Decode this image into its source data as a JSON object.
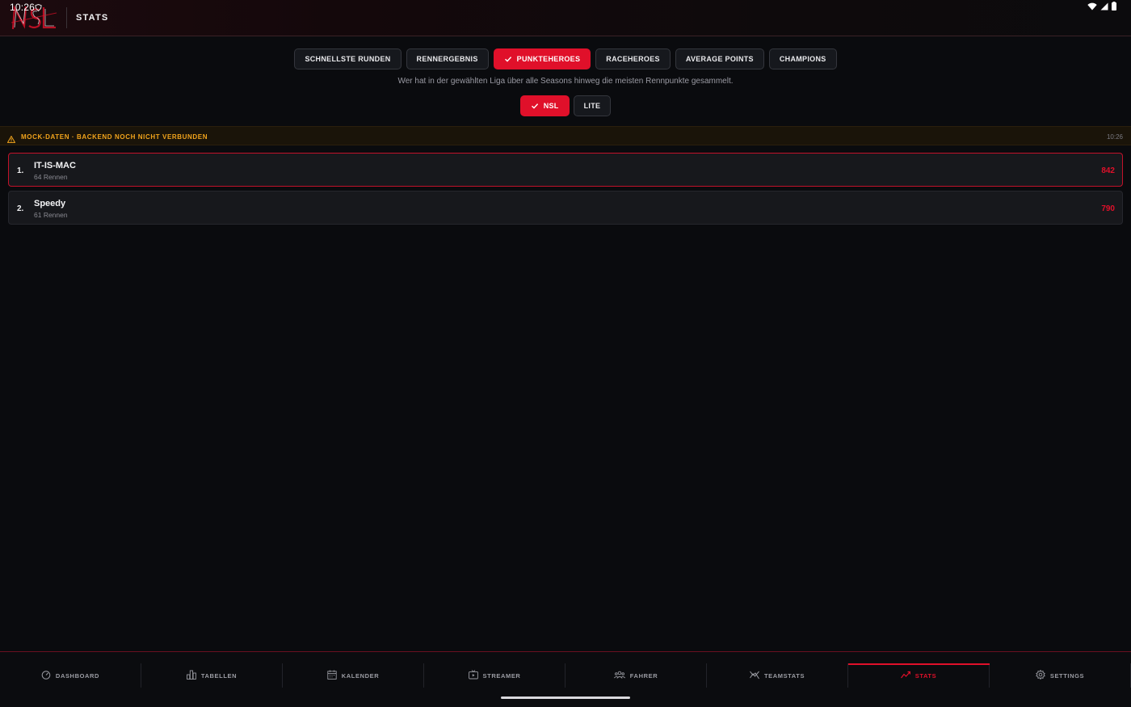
{
  "status_bar": {
    "time": "10:26"
  },
  "header": {
    "logo_text": "NSL",
    "title": "STATS"
  },
  "tabs": [
    {
      "label": "SCHNELLSTE RUNDEN",
      "active": false
    },
    {
      "label": "RENNERGEBNIS",
      "active": false
    },
    {
      "label": "PUNKTEHEROES",
      "active": true
    },
    {
      "label": "RACEHEROES",
      "active": false
    },
    {
      "label": "AVERAGE POINTS",
      "active": false
    },
    {
      "label": "CHAMPIONS",
      "active": false
    }
  ],
  "description": "Wer hat in der gewählten Liga über alle Seasons hinweg die meisten Rennpunkte gesammelt.",
  "league_tabs": [
    {
      "label": "NSL",
      "active": true
    },
    {
      "label": "LITE",
      "active": false
    }
  ],
  "banner": {
    "text": "MOCK-DATEN · BACKEND NOCH NICHT VERBUNDEN",
    "time": "10:26"
  },
  "leaderboard": [
    {
      "rank": "1.",
      "name": "IT-IS-MAC",
      "races": "64 Rennen",
      "points": "842"
    },
    {
      "rank": "2.",
      "name": "Speedy",
      "races": "61 Rennen",
      "points": "790"
    }
  ],
  "bottom_nav": [
    {
      "label": "DASHBOARD",
      "icon": "gauge-icon",
      "active": false
    },
    {
      "label": "TABELLEN",
      "icon": "bar-chart-icon",
      "active": false
    },
    {
      "label": "KALENDER",
      "icon": "calendar-icon",
      "active": false
    },
    {
      "label": "STREAMER",
      "icon": "tv-icon",
      "active": false
    },
    {
      "label": "FAHRER",
      "icon": "people-icon",
      "active": false
    },
    {
      "label": "TEAMSTATS",
      "icon": "trend-icon",
      "active": false
    },
    {
      "label": "STATS",
      "icon": "stats-line-icon",
      "active": true
    },
    {
      "label": "SETTINGS",
      "icon": "gear-icon",
      "active": false
    }
  ],
  "colors": {
    "accent": "#e0102a",
    "warning": "#f2a41c",
    "background": "#0a0b0e"
  }
}
